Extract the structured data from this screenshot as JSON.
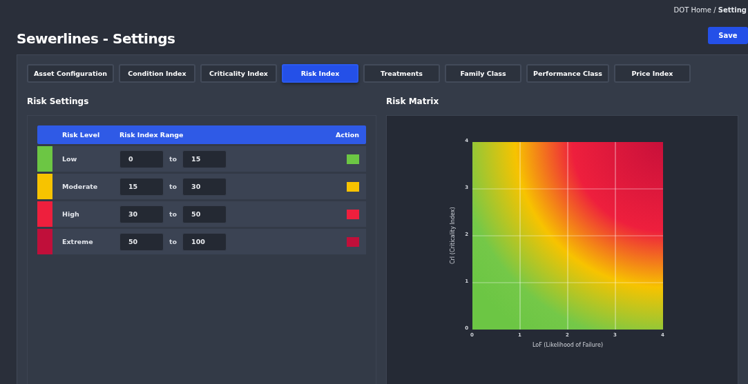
{
  "breadcrumb": {
    "home": "DOT Home",
    "separator": "/",
    "current": "Setting"
  },
  "page_title": "Sewerlines - Settings",
  "save_button": "Save",
  "tabs": [
    {
      "label": "Asset Configuration",
      "selected": false
    },
    {
      "label": "Condition Index",
      "selected": false
    },
    {
      "label": "Criticality Index",
      "selected": false
    },
    {
      "label": "Risk Index",
      "selected": true
    },
    {
      "label": "Treatments",
      "selected": false
    },
    {
      "label": "Family Class",
      "selected": false
    },
    {
      "label": "Performance Class",
      "selected": false
    },
    {
      "label": "Price Index",
      "selected": false
    }
  ],
  "risk_settings": {
    "title": "Risk Settings",
    "columns": [
      "Risk Level",
      "Risk Index Range",
      "Action"
    ],
    "rows": [
      {
        "level": "Low",
        "color": "#6cc644",
        "from": "0",
        "to_label": "to",
        "to": "15"
      },
      {
        "level": "Moderate",
        "color": "#f7c300",
        "from": "15",
        "to_label": "to",
        "to": "30"
      },
      {
        "level": "High",
        "color": "#ee1f3d",
        "from": "30",
        "to_label": "to",
        "to": "50"
      },
      {
        "level": "Extreme",
        "color": "#c00f3a",
        "from": "50",
        "to_label": "to",
        "to": "100"
      }
    ]
  },
  "risk_matrix": {
    "title": "Risk Matrix",
    "xlabel": "LoF (Likelihood of Failure)",
    "ylabel": "CrI (Criticality Index)",
    "xticks": [
      "0",
      "1",
      "2",
      "3",
      "4"
    ],
    "yticks": [
      "4",
      "3",
      "2",
      "1",
      "0"
    ]
  }
}
